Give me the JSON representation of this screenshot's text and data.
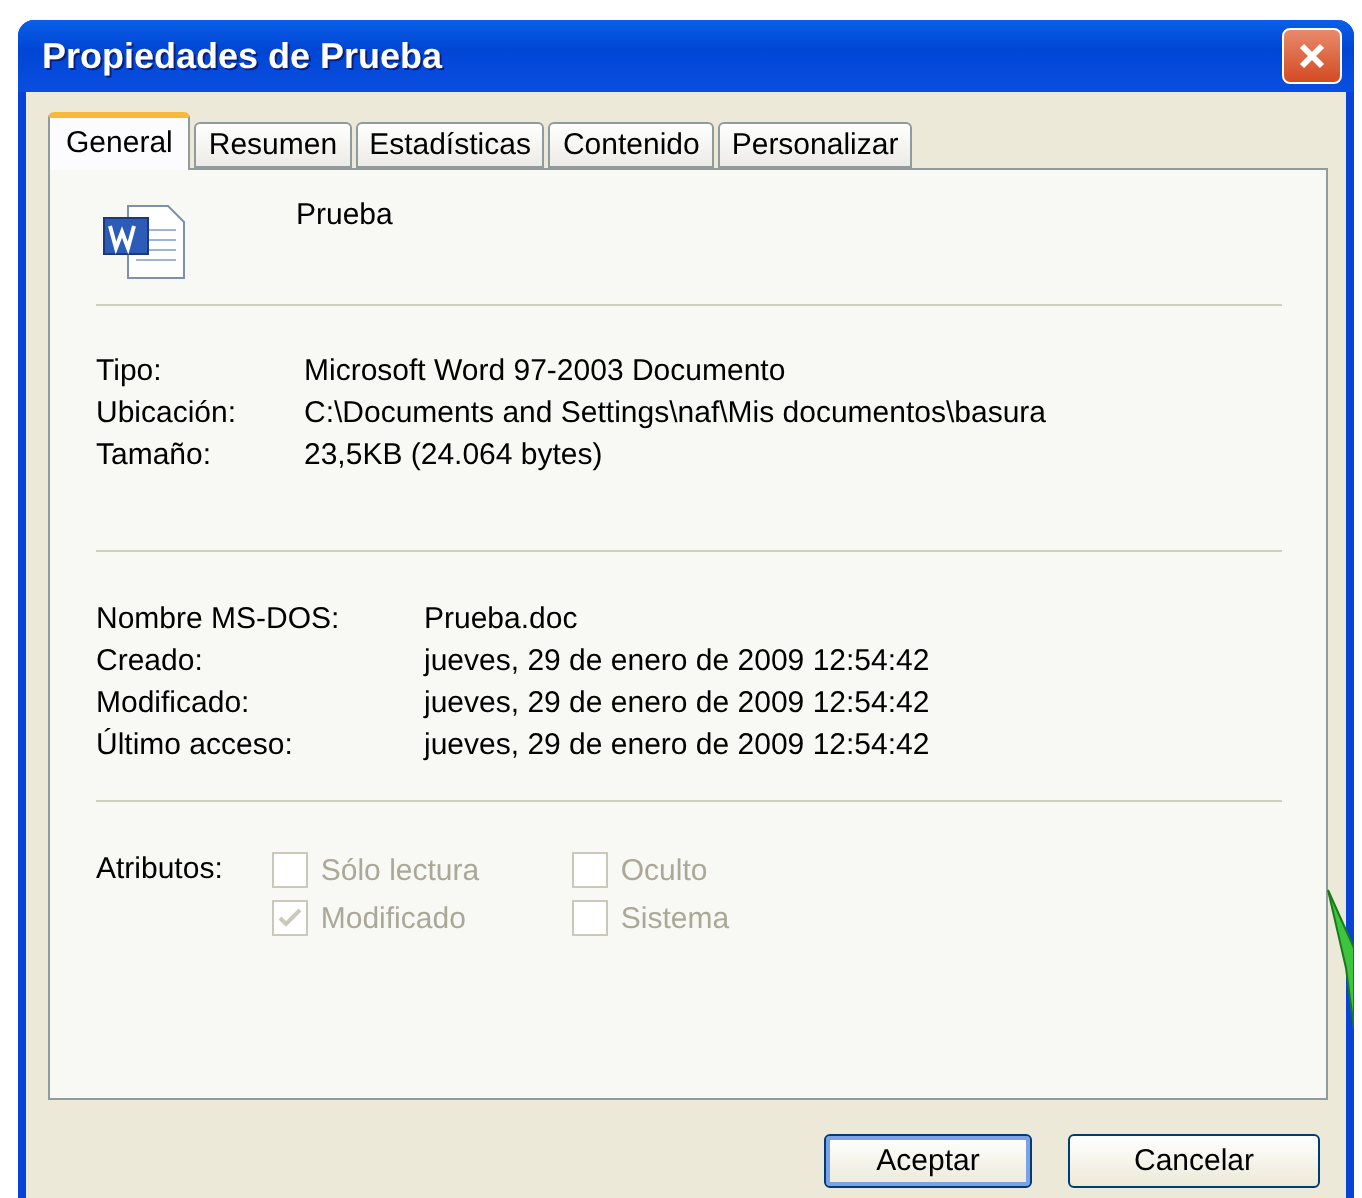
{
  "window": {
    "title": "Propiedades de Prueba"
  },
  "tabs": [
    {
      "label": "General",
      "selected": true
    },
    {
      "label": "Resumen",
      "selected": false
    },
    {
      "label": "Estadísticas",
      "selected": false
    },
    {
      "label": "Contenido",
      "selected": false
    },
    {
      "label": "Personalizar",
      "selected": false
    }
  ],
  "file_name": "Prueba",
  "file_info": [
    {
      "label": "Tipo:",
      "value": "Microsoft Word 97-2003 Documento"
    },
    {
      "label": "Ubicación:",
      "value": "C:\\Documents and Settings\\naf\\Mis documentos\\basura"
    },
    {
      "label": "Tamaño:",
      "value": "23,5KB (24.064 bytes)"
    }
  ],
  "dates": [
    {
      "label": "Nombre MS-DOS:",
      "value": "Prueba.doc"
    },
    {
      "label": "Creado:",
      "value": "jueves, 29 de enero de 2009 12:54:42"
    },
    {
      "label": "Modificado:",
      "value": "jueves, 29 de enero de 2009 12:54:42"
    },
    {
      "label": "Último acceso:",
      "value": "jueves, 29 de enero de 2009 12:54:42"
    }
  ],
  "attributes": {
    "label": "Atributos:",
    "items": [
      {
        "label": "Sólo lectura",
        "checked": false,
        "disabled": true
      },
      {
        "label": "Oculto",
        "checked": false,
        "disabled": true
      },
      {
        "label": "Modificado",
        "checked": true,
        "disabled": true
      },
      {
        "label": "Sistema",
        "checked": false,
        "disabled": true
      }
    ]
  },
  "buttons": [
    {
      "label": "Aceptar",
      "default": true
    },
    {
      "label": "Cancelar",
      "default": false
    }
  ]
}
